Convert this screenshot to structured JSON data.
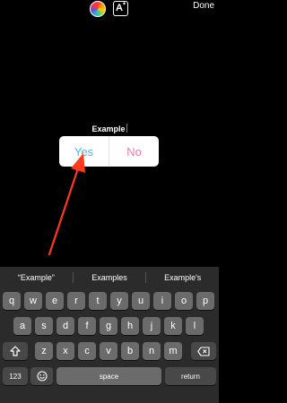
{
  "toolbar": {
    "color_wheel_icon": "color-wheel-icon",
    "text_style_icon": "text-style-icon",
    "text_style_glyph": "A",
    "done_label": "Done"
  },
  "sticker": {
    "title": "Example",
    "options": [
      "Yes",
      "No"
    ],
    "colors": {
      "yes": "#5bb4e5",
      "no": "#f07aa6"
    }
  },
  "annotation": {
    "arrow_color": "#ff3b1f"
  },
  "keyboard": {
    "suggestions": [
      "“Example”",
      "Examples",
      "Example's"
    ],
    "row1": [
      "q",
      "w",
      "e",
      "r",
      "t",
      "y",
      "u",
      "i",
      "o",
      "p"
    ],
    "row2": [
      "a",
      "s",
      "d",
      "f",
      "g",
      "h",
      "j",
      "k",
      "l"
    ],
    "row3": [
      "z",
      "x",
      "c",
      "v",
      "b",
      "n",
      "m"
    ],
    "shift_icon": "shift-icon",
    "backspace_icon": "backspace-icon",
    "numbers_label": "123",
    "emoji_icon": "emoji-icon",
    "space_label": "space",
    "return_label": "return"
  }
}
